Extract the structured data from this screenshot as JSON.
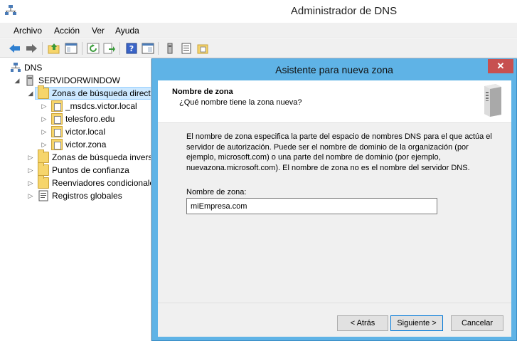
{
  "window": {
    "title": "Administrador de DNS"
  },
  "menu": [
    "Archivo",
    "Acción",
    "Ver",
    "Ayuda"
  ],
  "toolbar_icons": [
    "back-arrow-icon",
    "forward-arrow-icon",
    "up-folder-icon",
    "show-hide-tree-icon",
    "refresh-icon",
    "export-icon",
    "help-icon",
    "properties-icon",
    "server-icon",
    "list-icon",
    "folder-zone-icon"
  ],
  "tree": {
    "root": "DNS",
    "server": "SERVIDORWINDOW",
    "forward_zones": "Zonas de búsqueda directa",
    "zones": [
      "_msdcs.victor.local",
      "telesforo.edu",
      "victor.local",
      "victor.zona"
    ],
    "reverse_zones": "Zonas de búsqueda inversa",
    "trust_points": "Puntos de confianza",
    "forwarders": "Reenviadores condicionales",
    "global_logs": "Registros globales"
  },
  "dialog": {
    "title": "Asistente para nueva zona",
    "close": "✕",
    "header_title": "Nombre de zona",
    "header_subtitle": "¿Qué nombre tiene la zona  nueva?",
    "description": "El nombre de zona especifica la parte del espacio de nombres DNS para el que actúa el servidor de autorización. Puede ser el nombre de dominio de la organización (por ejemplo, microsoft.com) o una parte del nombre de dominio (por ejemplo, nuevazona.microsoft.com). El nombre de zona no es el nombre del servidor DNS.",
    "zone_label": "Nombre de zona:",
    "zone_value": "miEmpresa.com",
    "back": "< Atrás",
    "next": "Siguiente >",
    "cancel": "Cancelar"
  },
  "colors": {
    "dialog_frame": "#5fb3e6",
    "close_button": "#c75050",
    "selection": "#cce8ff"
  }
}
